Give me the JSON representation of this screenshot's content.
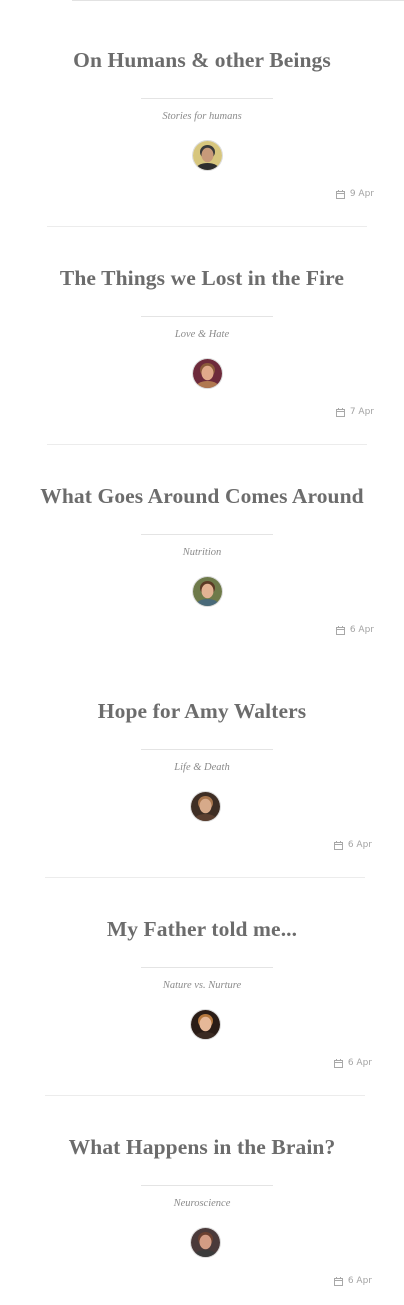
{
  "posts": [
    {
      "title": "On Humans & other Beings",
      "category": "Stories for humans",
      "date": "9 Apr",
      "avatar": {
        "bg": "#d7c67e",
        "skin": "#c89a7a",
        "hair": "#3a3a3a",
        "shirt": "#2e2e2e"
      }
    },
    {
      "title": "The Things we Lost in the Fire",
      "category": "Love & Hate",
      "date": "7 Apr",
      "avatar": {
        "bg": "#6d2a3b",
        "skin": "#e0a98a",
        "hair": "#8a5a3a",
        "shirt": "#b07850"
      }
    },
    {
      "title": "What Goes Around Comes Around",
      "category": "Nutrition",
      "date": "6 Apr",
      "avatar": {
        "bg": "#6e7a4a",
        "skin": "#e3b393",
        "hair": "#5b3a25",
        "shirt": "#4a6a7a"
      }
    },
    {
      "title": "Hope for Amy Walters",
      "category": "Life & Death",
      "date": "6 Apr",
      "avatar": {
        "bg": "#3e2e24",
        "skin": "#d7aa8a",
        "hair": "#a8764d",
        "shirt": "#5a3f30"
      }
    },
    {
      "title": "My Father told me...",
      "category": "Nature vs. Nurture",
      "date": "6 Apr",
      "avatar": {
        "bg": "#2a1c16",
        "skin": "#e6b898",
        "hair": "#b5783e",
        "shirt": "#3a2a22"
      }
    },
    {
      "title": "What Happens in the Brain?",
      "category": "Neuroscience",
      "date": "6 Apr",
      "avatar": {
        "bg": "#4a3a3a",
        "skin": "#d39c84",
        "hair": "#6a4030",
        "shirt": "#3b3b3b"
      }
    }
  ]
}
